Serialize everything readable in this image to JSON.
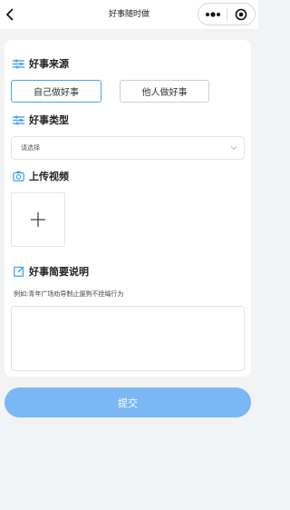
{
  "navbar": {
    "title": "好事随时做",
    "back_icon": "chevron-left-icon",
    "more_icon": "more-dots-icon",
    "close_icon": "target-close-icon"
  },
  "form": {
    "source": {
      "title": "好事来源",
      "icon": "sliders-icon",
      "options": [
        "自己做好事",
        "他人做好事"
      ],
      "selected": "自己做好事"
    },
    "type": {
      "title": "好事类型",
      "icon": "sliders-icon",
      "placeholder": "请选择"
    },
    "video": {
      "title": "上传视频",
      "icon": "camera-icon"
    },
    "description": {
      "title": "好事简要说明",
      "icon": "edit-icon",
      "hint": "例如:青年广场劝导制止遛狗不拴绳行为"
    }
  },
  "submit_label": "提交",
  "colors": {
    "accent": "#4aa3f0",
    "submit_bg": "#7bb7f4",
    "page_bg": "#f2f3f5"
  }
}
